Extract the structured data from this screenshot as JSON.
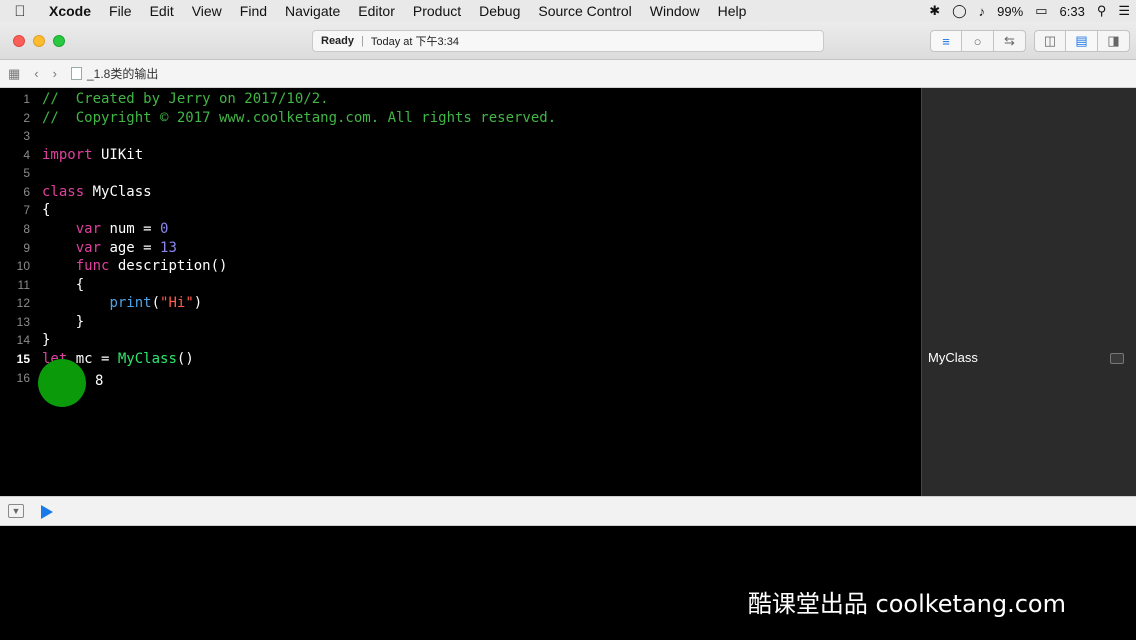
{
  "menubar": {
    "apple": "",
    "items": [
      "Xcode",
      "File",
      "Edit",
      "View",
      "Find",
      "Navigate",
      "Editor",
      "Product",
      "Debug",
      "Source Control",
      "Window",
      "Help"
    ],
    "battery": "99%",
    "time": "6:33"
  },
  "toolbar": {
    "status_ready": "Ready",
    "status_time": "Today at 下午3:34"
  },
  "jumpbar": {
    "filename": "_1.8类的输出"
  },
  "editor": {
    "line_numbers": [
      "1",
      "2",
      "3",
      "4",
      "5",
      "6",
      "7",
      "8",
      "9",
      "10",
      "11",
      "12",
      "13",
      "14",
      "15",
      "16"
    ],
    "current_line": "15",
    "typed_text": "8"
  },
  "results": {
    "line15": "MyClass"
  },
  "watermark": "酷课堂出品 coolketang.com",
  "colors": {
    "comment": "#41b645",
    "keyword": "#e0409e",
    "number": "#8b86f0",
    "string": "#ff5a4c",
    "function": "#4ea3e8",
    "type": "#2ee76f",
    "cursor_indicator": "#0a9a0a"
  }
}
